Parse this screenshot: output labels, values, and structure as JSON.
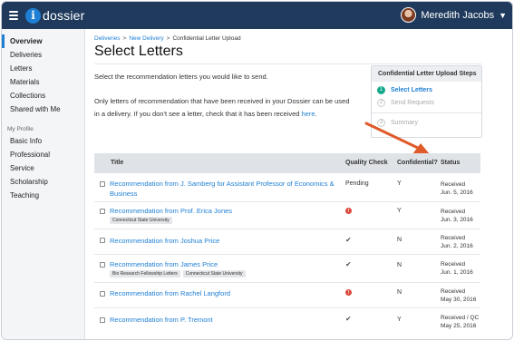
{
  "app": {
    "logo_letter": "i",
    "name": "dossier",
    "user_name": "Meredith Jacobs"
  },
  "colors": {
    "topbar": "#1f3a5c",
    "accent": "#1f7fd4",
    "step_active": "#15a88a",
    "error": "#d9483b",
    "arrow": "#e05a2a"
  },
  "sidebar": {
    "items": [
      {
        "label": "Overview",
        "active": true
      },
      {
        "label": "Deliveries"
      },
      {
        "label": "Letters"
      },
      {
        "label": "Materials"
      },
      {
        "label": "Collections"
      },
      {
        "label": "Shared with Me"
      }
    ],
    "profile_heading": "My Profile",
    "profile_items": [
      {
        "label": "Basic Info"
      },
      {
        "label": "Professional"
      },
      {
        "label": "Service"
      },
      {
        "label": "Scholarship"
      },
      {
        "label": "Teaching"
      }
    ]
  },
  "breadcrumb": {
    "items": [
      "Deliveries",
      "New Delivery",
      "Confidential Letter Upload"
    ]
  },
  "page": {
    "title": "Select Letters",
    "instruction": "Select the recommendation letters you would like to send.",
    "note_line1": "Only letters of recommendation that have been received in your Dossier can be used",
    "note_line2_pre": "in a delivery. If you don't see a letter, check that it has been received ",
    "note_link": "here",
    "note_end": "."
  },
  "steps": {
    "heading": "Confidential Letter Upload Steps",
    "items": [
      {
        "num": "1",
        "label": "Select Letters",
        "active": true
      },
      {
        "num": "2",
        "label": "Send Requests",
        "active": false
      },
      {
        "num": "3",
        "label": "Summary",
        "active": false
      }
    ]
  },
  "table": {
    "headers": {
      "title": "Title",
      "quality": "Quality Check",
      "confidential": "Confidential?",
      "status": "Status"
    },
    "rows": [
      {
        "title": "Recommendation from J. Samberg for Assistant Professor of Economics & Business",
        "tags": [],
        "quality": "Pending",
        "quality_icon": "",
        "confidential": "Y",
        "status_line1": "Received",
        "status_line2": "Jun. 5, 2016"
      },
      {
        "title": "Recommendation from Prof. Erica Jones",
        "tags": [
          "Connecticut State University"
        ],
        "quality": "",
        "quality_icon": "error-icon",
        "confidential": "Y",
        "status_line1": "Received",
        "status_line2": "Jun. 3, 2016"
      },
      {
        "title": "Recommendation from Joshua Price",
        "tags": [],
        "quality": "",
        "quality_icon": "check-icon",
        "confidential": "N",
        "status_line1": "Received",
        "status_line2": "Jun. 2, 2016"
      },
      {
        "title": "Recommendation from James Price",
        "tags": [
          "Bio Research Fellowship Letters",
          "Connecticut State University"
        ],
        "quality": "",
        "quality_icon": "check-icon",
        "confidential": "N",
        "status_line1": "Received",
        "status_line2": "Jun. 1, 2016"
      },
      {
        "title": "Recommendation from Rachel Langford",
        "tags": [],
        "quality": "",
        "quality_icon": "error-icon",
        "confidential": "N",
        "status_line1": "Received",
        "status_line2": "May 30, 2016"
      },
      {
        "title": "Recommendation from P. Tremont",
        "tags": [],
        "quality": "",
        "quality_icon": "check-icon",
        "confidential": "Y",
        "status_line1": "Received / QC",
        "status_line2": "May 25, 2016"
      }
    ]
  }
}
